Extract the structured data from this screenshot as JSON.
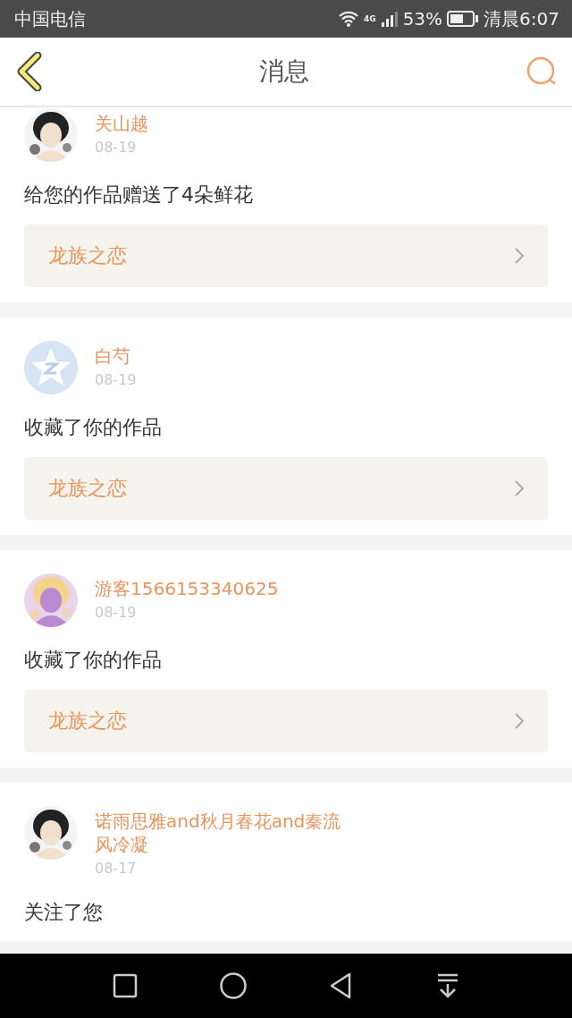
{
  "status_bar": {
    "carrier": "中国电信",
    "network": "4G",
    "battery": "53%",
    "time": "清晨6:07"
  },
  "header": {
    "title": "消息"
  },
  "messages": [
    {
      "user": "关山越",
      "date": "08-19",
      "text": "给您的作品赠送了4朵鲜花",
      "work": "龙族之恋"
    },
    {
      "user": "白芍",
      "date": "08-19",
      "avatar": {
        "kind": "default"
      },
      "text": "收藏了你的作品",
      "work": "龙族之恋"
    },
    {
      "user": "游客1566153340625",
      "date": "08-19",
      "text": "收藏了你的作品",
      "work": "龙族之恋"
    },
    {
      "user": "诺雨思雅and秋月春花and秦流风冷凝",
      "date": "08-17",
      "text": "关注了您"
    }
  ]
}
